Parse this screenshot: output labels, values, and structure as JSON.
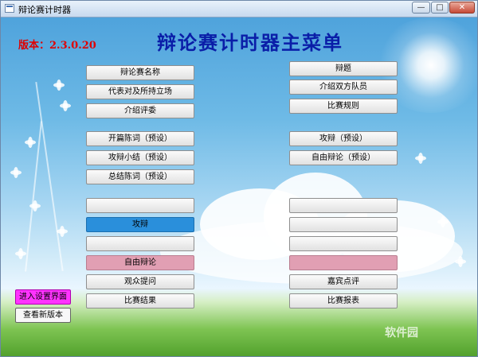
{
  "window": {
    "title": "辩论赛计时器"
  },
  "version_label": "版本：2.3.0.20",
  "main_title": "辩论赛计时器主菜单",
  "left_buttons": [
    {
      "label": "辩论赛名称"
    },
    {
      "label": "代表对及所持立场"
    },
    {
      "label": "介绍评委"
    },
    {
      "label": "开篇陈词（预设）"
    },
    {
      "label": "攻辩小结（预设）"
    },
    {
      "label": "总结陈词（预设）"
    },
    {
      "label": ""
    },
    {
      "label": "攻辩"
    },
    {
      "label": ""
    },
    {
      "label": "自由辩论"
    },
    {
      "label": "观众提问"
    },
    {
      "label": "比赛结果"
    }
  ],
  "right_buttons": [
    {
      "label": "辩题"
    },
    {
      "label": "介绍双方队员"
    },
    {
      "label": "比赛规则"
    },
    {
      "label": "攻辩（预设）"
    },
    {
      "label": "自由辩论（预设）"
    },
    {
      "label": ""
    },
    {
      "label": ""
    },
    {
      "label": ""
    },
    {
      "label": ""
    },
    {
      "label": "嘉宾点评"
    },
    {
      "label": "比赛报表"
    }
  ],
  "settings_button": "进入设置界面",
  "new_version_button": "查看新版本",
  "watermark": "软件园",
  "colors": {
    "title_blue": "#0a1ea8",
    "version_red": "#e00000",
    "active_blue": "#2a8fdb",
    "pink": "#e19fb3",
    "magenta": "#ff33ff"
  }
}
